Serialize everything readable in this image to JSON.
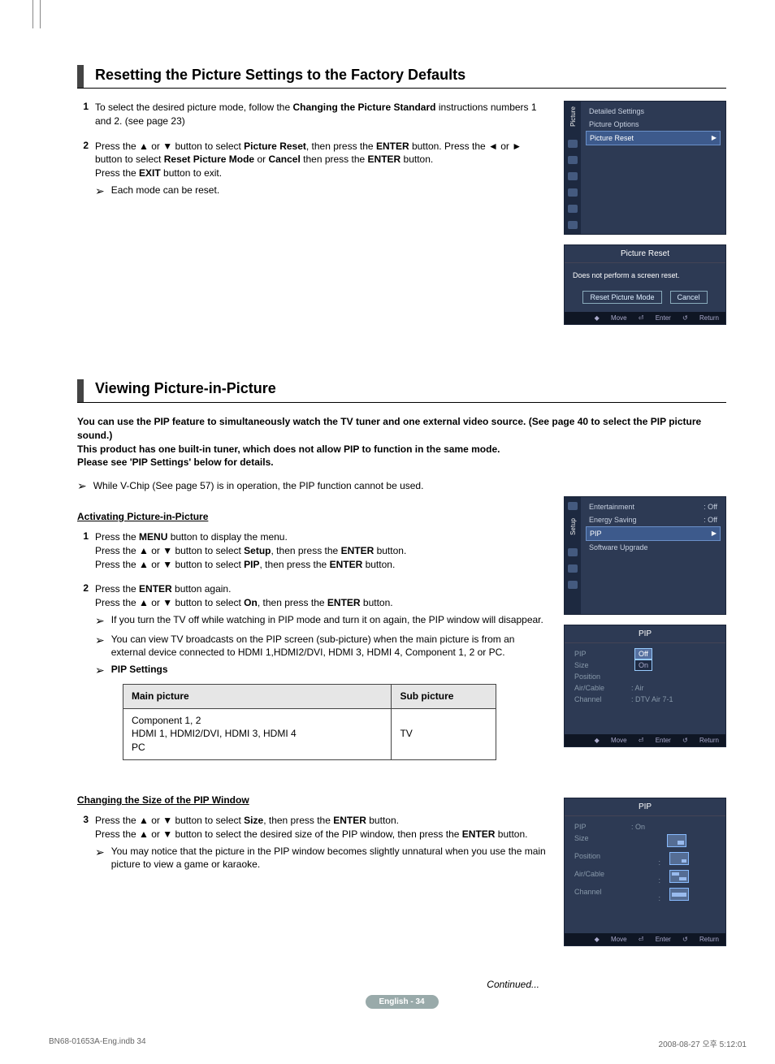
{
  "section1": {
    "heading": "Resetting the Picture Settings to the Factory Defaults",
    "step1_num": "1",
    "step1_a": "To select the desired picture mode, follow the ",
    "step1_b": "Changing the Picture Standard",
    "step1_c": " instructions numbers 1 and 2. (see page 23)",
    "step2_num": "2",
    "step2_a": "Press the ▲ or ▼ button to select ",
    "step2_b": "Picture Reset",
    "step2_c": ", then press the ",
    "step2_d": "ENTER",
    "step2_e": " button. Press the ◄ or ► button to select ",
    "step2_f": "Reset Picture Mode",
    "step2_g": " or ",
    "step2_h": "Cancel",
    "step2_i": " then press the ",
    "step2_j": "ENTER",
    "step2_k": " button.",
    "step2_l": "Press the ",
    "step2_m": "EXIT",
    "step2_n": " button to exit.",
    "bullet1": "Each mode can be reset."
  },
  "osd1": {
    "rail_label": "Picture",
    "item1": "Detailed Settings",
    "item2": "Picture Options",
    "item3": "Picture Reset"
  },
  "osd2": {
    "title": "Picture Reset",
    "msg": "Does not perform a screen reset.",
    "btn1": "Reset Picture Mode",
    "btn2": "Cancel"
  },
  "footer_osd": {
    "move": "Move",
    "enter": "Enter",
    "ret": "Return"
  },
  "section2": {
    "heading": "Viewing Picture-in-Picture",
    "intro1": "You can use the PIP feature to simultaneously watch the TV tuner and one external video source. (See page 40 to select the PIP picture sound.)",
    "intro2": "This product has one built-in tuner, which does not allow PIP to function in the same mode.",
    "intro3": "Please see 'PIP Settings' below for details.",
    "note": "While V-Chip (See page 57) is in operation, the PIP function cannot be used.",
    "sub1": "Activating Picture-in-Picture",
    "s1n": "1",
    "s1a": "Press the ",
    "s1b": "MENU",
    "s1c": " button to display the menu.",
    "s1d": "Press the ▲ or ▼ button to select ",
    "s1e": "Setup",
    "s1f": ", then press the ",
    "s1g": "ENTER",
    "s1h": " button.",
    "s1i": "Press the ▲ or ▼ button to select ",
    "s1j": "PIP",
    "s1k": ", then press the ",
    "s1l": "ENTER",
    "s1m": " button.",
    "s2n": "2",
    "s2a": "Press the ",
    "s2b": "ENTER",
    "s2c": " button again.",
    "s2d": "Press the ▲ or ▼ button to select ",
    "s2e": "On",
    "s2f": ", then press the ",
    "s2g": "ENTER",
    "s2h": " button.",
    "b1": "If you turn the TV off while watching in PIP mode and turn it on again, the PIP window will disappear.",
    "b2": "You can view TV broadcasts on the PIP screen (sub-picture) when the main picture is from an external device connected to HDMI 1,HDMI2/DVI, HDMI 3, HDMI 4, Component 1, 2 or PC.",
    "b3": "PIP Settings",
    "th1": "Main picture",
    "th2": "Sub picture",
    "td1": "Component 1, 2\nHDMI 1, HDMI2/DVI, HDMI 3, HDMI 4\nPC",
    "td2": "TV",
    "sub2": "Changing the Size of the PIP Window",
    "s3n": "3",
    "s3a": "Press the ▲ or ▼ button to select ",
    "s3b": "Size",
    "s3c": ", then press the ",
    "s3d": "ENTER",
    "s3e": " button.",
    "s3f": "Press the ▲ or ▼ button to select the desired size of the PIP window, then press the ",
    "s3g": "ENTER",
    "s3h": " button.",
    "b4": "You may notice that the picture in the PIP window becomes slightly unnatural when you use the main picture to view a game or karaoke."
  },
  "osd3": {
    "rail_label": "Setup",
    "i1": "Entertainment",
    "v1": ": Off",
    "i2": "Energy Saving",
    "v2": ": Off",
    "i3": "PIP",
    "i4": "Software Upgrade"
  },
  "osd4": {
    "title": "PIP",
    "r1": "PIP",
    "v1a": "Off",
    "v1b": "On",
    "r2": "Size",
    "r3": "Position",
    "r4": "Air/Cable",
    "v4": ": Air",
    "r5": "Channel",
    "v5": ": DTV Air 7-1"
  },
  "osd5": {
    "title": "PIP",
    "r1": "PIP",
    "v1": ": On",
    "r2": "Size",
    "r3": "Position",
    "r4": "Air/Cable",
    "r5": "Channel"
  },
  "continued": "Continued...",
  "page_num": "English - 34",
  "footer": {
    "left": "BN68-01653A-Eng.indb   34",
    "right": "2008-08-27   오후 5:12:01"
  }
}
